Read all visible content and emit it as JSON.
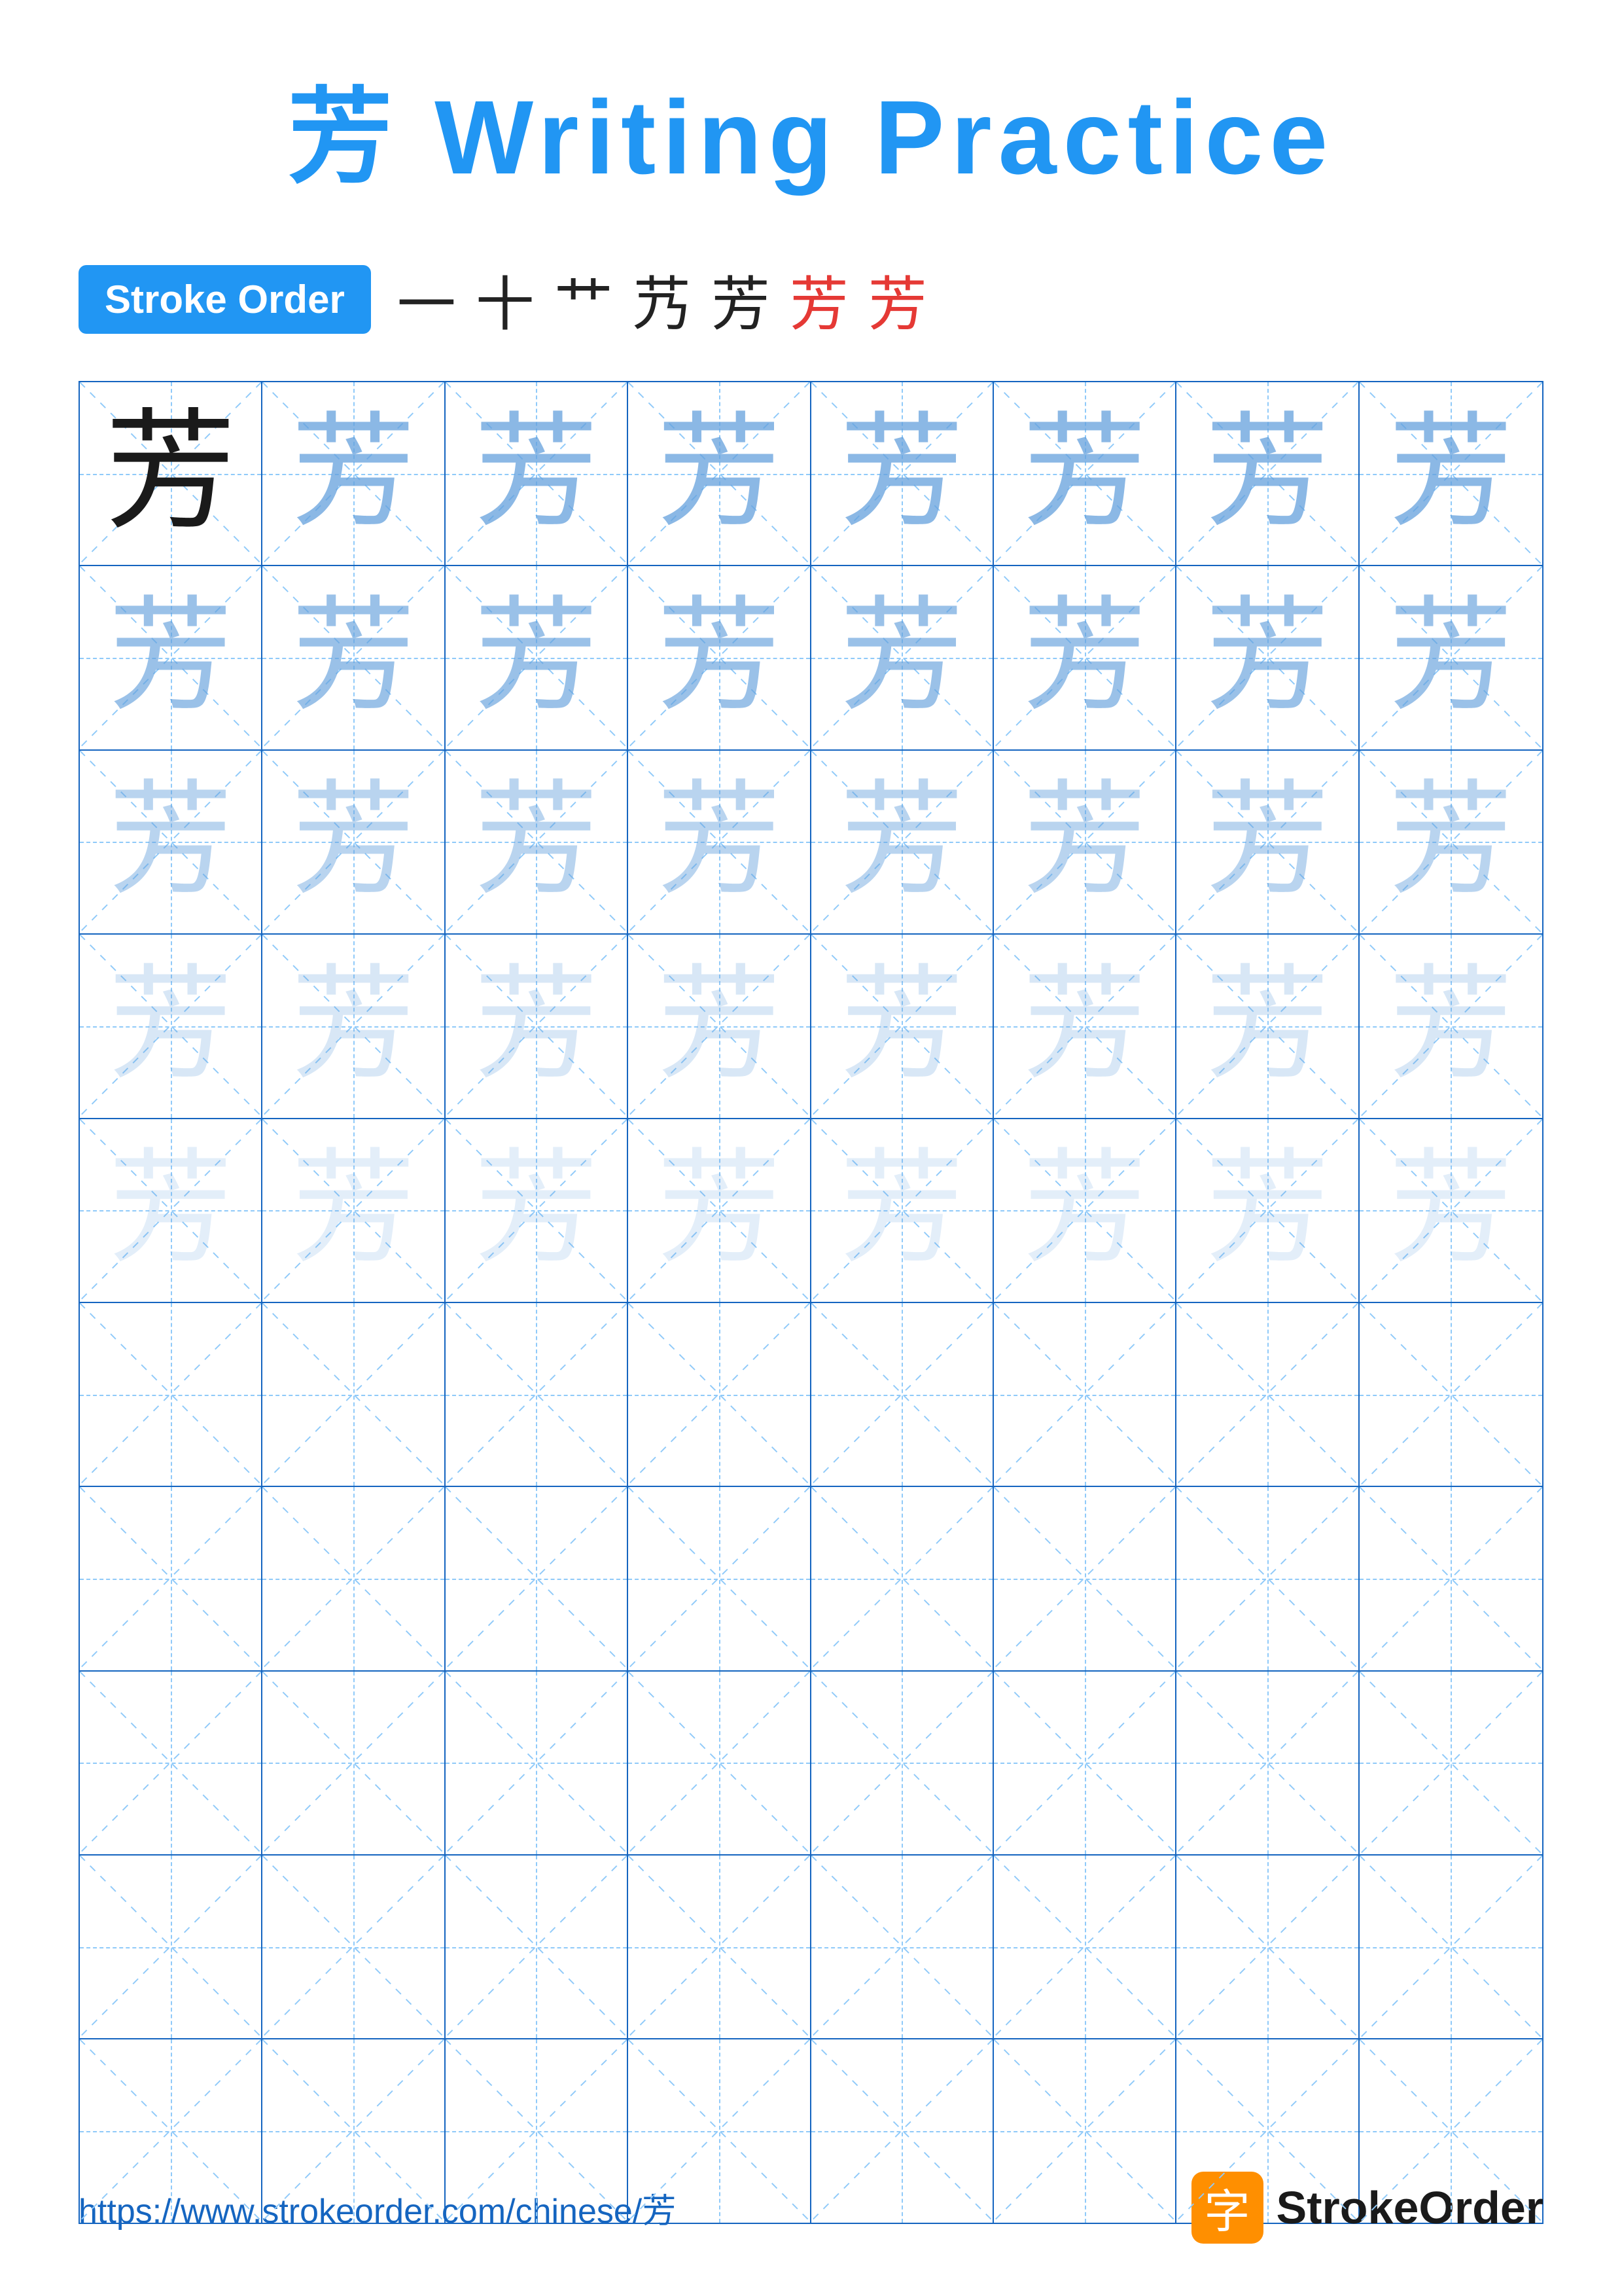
{
  "title": "芳 Writing Practice",
  "stroke_order": {
    "label": "Stroke Order",
    "sequence": [
      "一",
      "十",
      "艹",
      "艿",
      "芳",
      "芳",
      "芳"
    ]
  },
  "character": "芳",
  "grid": {
    "rows": 10,
    "cols": 8,
    "practice_rows": 5,
    "empty_rows": 5
  },
  "footer": {
    "url": "https://www.strokeorder.com/chinese/芳",
    "brand": "StrokeOrder"
  }
}
